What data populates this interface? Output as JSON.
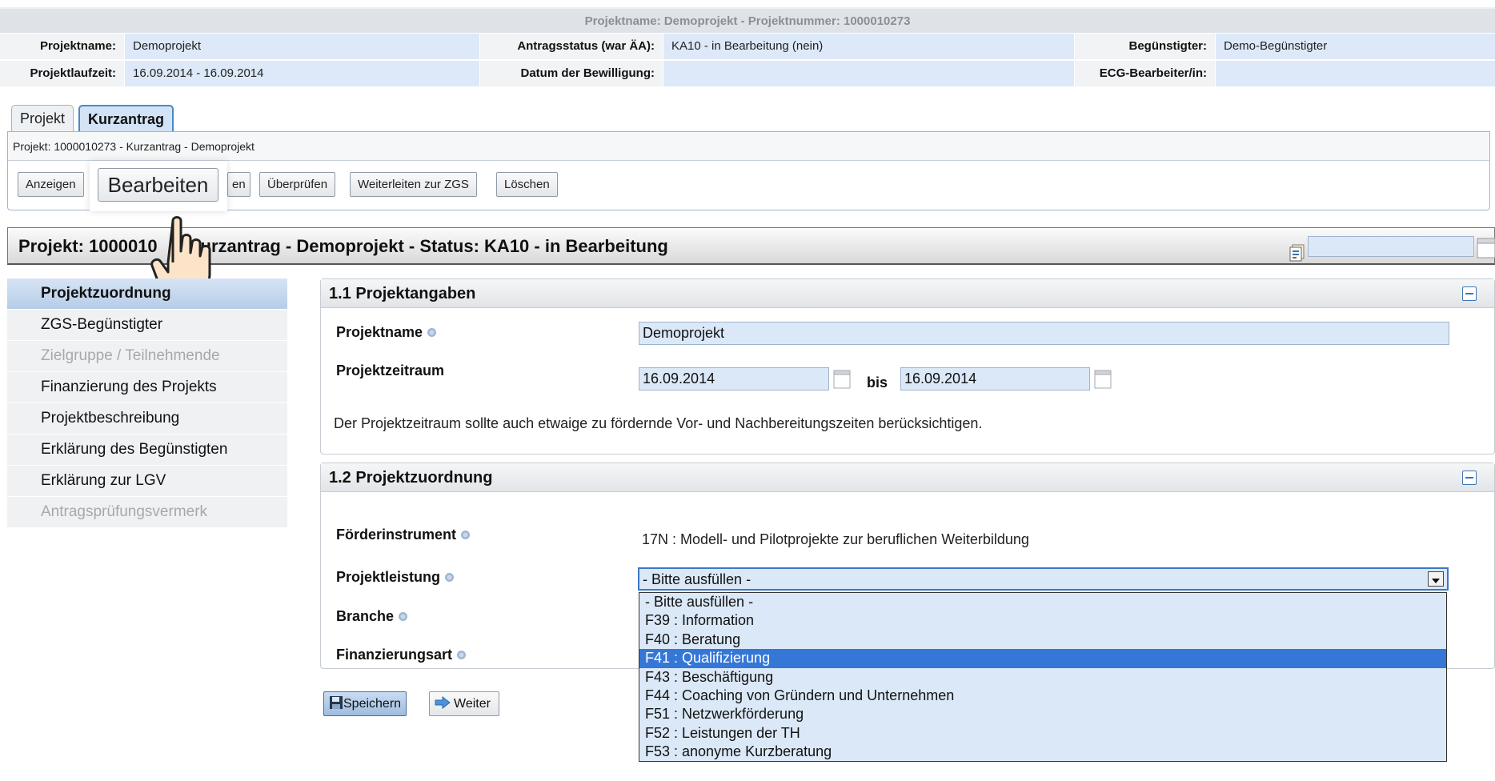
{
  "header": {
    "title": "Projektname: Demoprojekt - Projektnummer: 1000010273",
    "rows": [
      [
        {
          "label": "Projektname:",
          "value": "Demoprojekt"
        },
        {
          "label": "Antragsstatus (war ÄA):",
          "value": "KA10 - in Bearbeitung (nein)"
        },
        {
          "label": "Begünstigter:",
          "value": "Demo-Begünstigter"
        }
      ],
      [
        {
          "label": "Projektlaufzeit:",
          "value": "16.09.2014 - 16.09.2014"
        },
        {
          "label": "Datum der Bewilligung:",
          "value": ""
        },
        {
          "label": "ECG-Bearbeiter/in:",
          "value": ""
        }
      ]
    ]
  },
  "tabs": [
    {
      "label": "Projekt",
      "active": false
    },
    {
      "label": "Kurzantrag",
      "active": true
    }
  ],
  "panel": {
    "breadcrumb": "Projekt: 1000010273 - Kurzantrag - Demoprojekt",
    "buttons": {
      "anzeigen": "Anzeigen",
      "bearbeiten_partial": "en",
      "ueberpruefen": "Überprüfen",
      "weiterleiten": "Weiterleiten zur ZGS",
      "loeschen": "Löschen"
    },
    "hover_button": "Bearbeiten"
  },
  "status": {
    "part1": "Projekt: 1000010",
    "part2": "Kurzantrag - Demoprojekt - Status: KA10 - in Bearbeitung"
  },
  "nav": [
    {
      "label": "Projektzuordnung",
      "state": "active"
    },
    {
      "label": "ZGS-Begünstigter",
      "state": "normal"
    },
    {
      "label": "Zielgruppe / Teilnehmende",
      "state": "disabled"
    },
    {
      "label": "Finanzierung des Projekts",
      "state": "normal"
    },
    {
      "label": "Projektbeschreibung",
      "state": "normal"
    },
    {
      "label": "Erklärung des Begünstigten",
      "state": "normal"
    },
    {
      "label": "Erklärung zur LGV",
      "state": "normal"
    },
    {
      "label": "Antragsprüfungsvermerk",
      "state": "disabled"
    }
  ],
  "section1": {
    "title": "1.1 Projektangaben",
    "projektname_label": "Projektname",
    "projektname_value": "Demoprojekt",
    "zeitraum_label": "Projektzeitraum",
    "zeitraum_from": "16.09.2014",
    "zeitraum_bis": "bis",
    "zeitraum_to": "16.09.2014",
    "hint": "Der Projektzeitraum sollte auch etwaige zu fördernde Vor- und Nachbereitungszeiten berücksichtigen."
  },
  "section2": {
    "title": "1.2 Projektzuordnung",
    "foerder_label": "Förderinstrument",
    "foerder_value": "17N : Modell- und Pilotprojekte zur beruflichen Weiterbildung",
    "leistung_label": "Projektleistung",
    "leistung_selected": "- Bitte ausfüllen -",
    "branche_label": "Branche",
    "finanz_label": "Finanzierungsart",
    "dropdown_options": [
      {
        "label": "- Bitte ausfüllen -",
        "highlighted": false
      },
      {
        "label": "F39 : Information",
        "highlighted": false
      },
      {
        "label": "F40 : Beratung",
        "highlighted": false
      },
      {
        "label": "F41 : Qualifizierung",
        "highlighted": true
      },
      {
        "label": "F43 : Beschäftigung",
        "highlighted": false
      },
      {
        "label": "F44 : Coaching von Gründern und Unternehmen",
        "highlighted": false
      },
      {
        "label": "F51 : Netzwerkförderung",
        "highlighted": false
      },
      {
        "label": "F52 : Leistungen der TH",
        "highlighted": false
      },
      {
        "label": "F53 : anonyme Kurzberatung",
        "highlighted": false
      }
    ]
  },
  "actions": {
    "save": "Speichern",
    "next": "Weiter"
  },
  "colors": {
    "accent": "#3577d6",
    "field_bg": "#dbe8f7",
    "nav_active": "#b6cde7"
  }
}
